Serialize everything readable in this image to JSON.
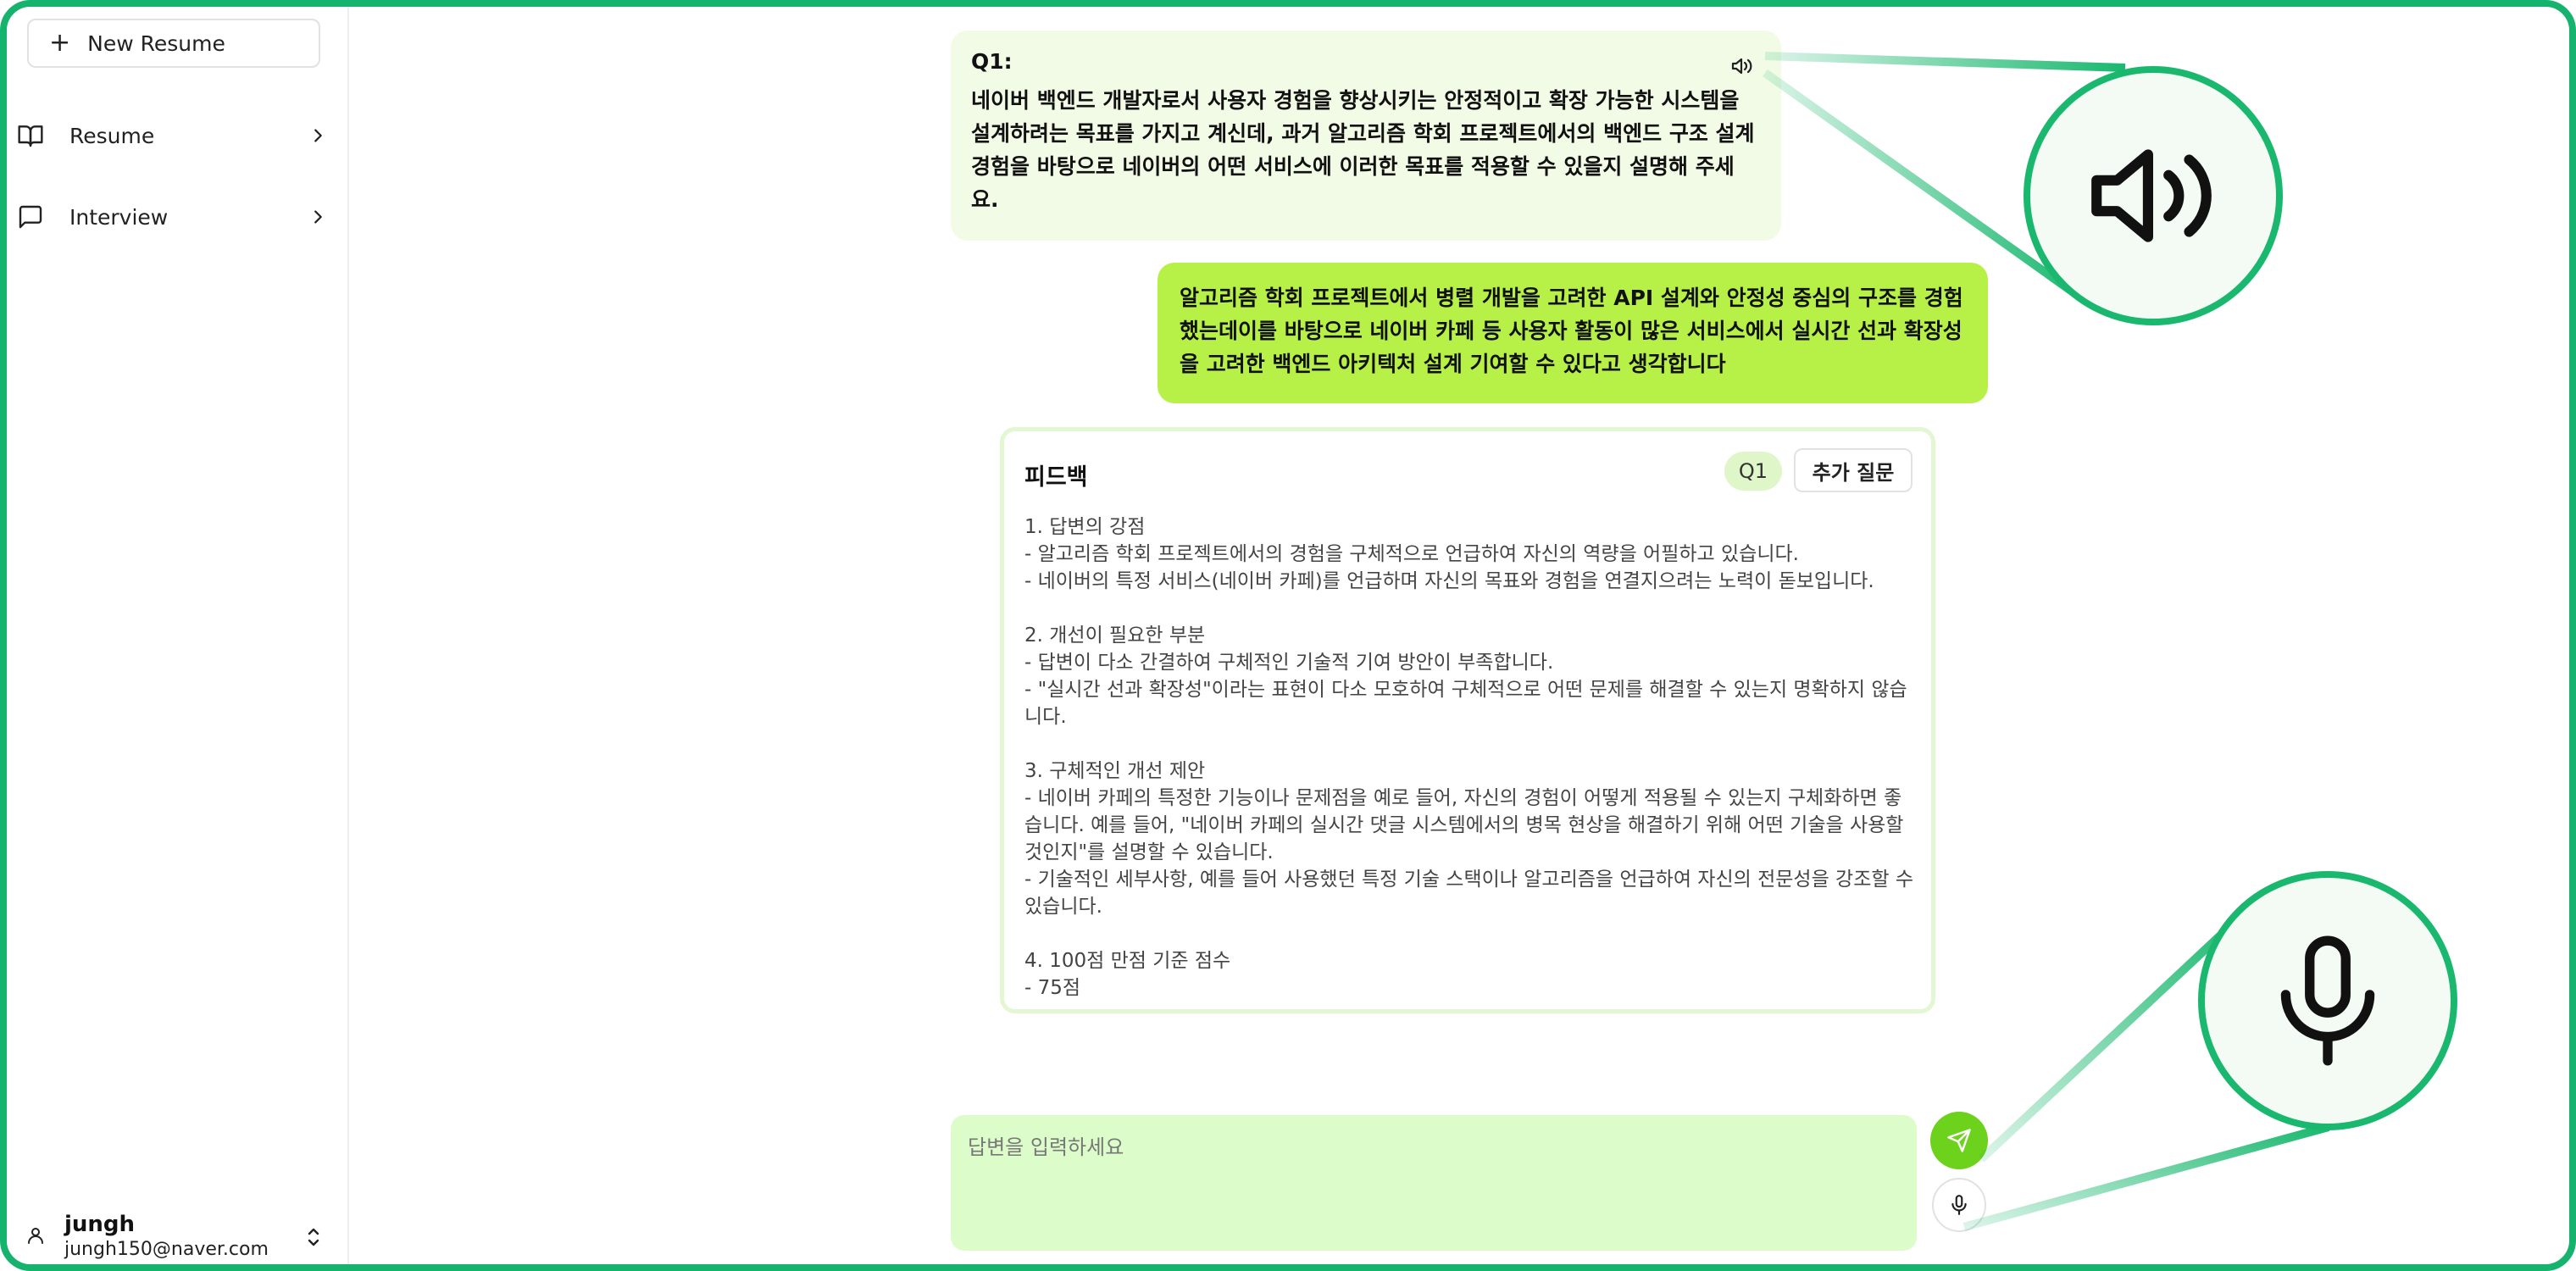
{
  "sidebar": {
    "new_resume_label": "New Resume",
    "items": [
      {
        "label": "Resume",
        "icon": "book-icon"
      },
      {
        "label": "Interview",
        "icon": "chat-icon"
      }
    ],
    "user": {
      "name": "jungh",
      "email": "jungh150@naver.com"
    }
  },
  "question": {
    "label": "Q1:",
    "text": "네이버 백엔드 개발자로서 사용자 경험을 향상시키는 안정적이고 확장 가능한 시스템을 설계하려는 목표를 가지고 계신데, 과거 알고리즘 학회 프로젝트에서의 백엔드 구조 설계 경험을 바탕으로 네이버의 어떤 서비스에 이러한 목표를 적용할 수 있을지 설명해 주세요."
  },
  "answer": {
    "text": "알고리즘 학회 프로젝트에서 병렬 개발을 고려한 API 설계와 안정성 중심의 구조를 경험했는데이를 바탕으로 네이버 카페 등 사용자 활동이 많은 서비스에서 실시간 선과 확장성을 고려한 백엔드 아키텍처 설계 기여할 수 있다고 생각합니다"
  },
  "feedback": {
    "title": "피드백",
    "badge": "Q1",
    "followup_label": "추가 질문",
    "body": "1. 답변의 강점\n- 알고리즘 학회 프로젝트에서의 경험을 구체적으로 언급하여 자신의 역량을 어필하고 있습니다.\n- 네이버의 특정 서비스(네이버 카페)를 언급하며 자신의 목표와 경험을 연결지으려는 노력이 돋보입니다.\n\n2. 개선이 필요한 부분\n- 답변이 다소 간결하여 구체적인 기술적 기여 방안이 부족합니다.\n- \"실시간 선과 확장성\"이라는 표현이 다소 모호하여 구체적으로 어떤 문제를 해결할 수 있는지 명확하지 않습니다.\n\n3. 구체적인 개선 제안\n- 네이버 카페의 특정한 기능이나 문제점을 예로 들어, 자신의 경험이 어떻게 적용될 수 있는지 구체화하면 좋습니다. 예를 들어, \"네이버 카페의 실시간 댓글 시스템에서의 병목 현상을 해결하기 위해 어떤 기술을 사용할 것인지\"를 설명할 수 있습니다.\n- 기술적인 세부사항, 예를 들어 사용했던 특정 기술 스택이나 알고리즘을 언급하여 자신의 전문성을 강조할 수 있습니다.\n\n4. 100점 만점 기준 점수\n- 75점"
  },
  "input": {
    "placeholder": "답변을 입력하세요"
  },
  "colors": {
    "frame": "#16b36e",
    "question_bg": "#f1fbe6",
    "answer_bg": "#b7f047",
    "input_bg": "#dcfcc9",
    "send_bg": "#6cd21b"
  }
}
